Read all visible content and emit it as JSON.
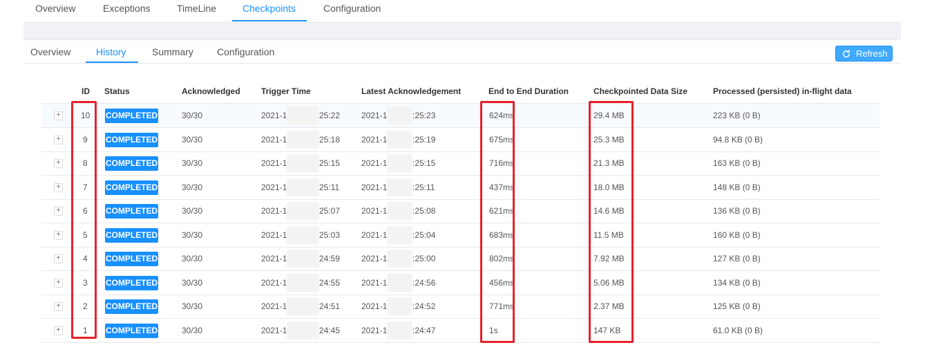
{
  "top_tabs": [
    "Overview",
    "Exceptions",
    "TimeLine",
    "Checkpoints",
    "Configuration"
  ],
  "top_active": "Checkpoints",
  "sub_tabs": [
    "Overview",
    "History",
    "Summary",
    "Configuration"
  ],
  "sub_active": "History",
  "refresh_label": "Refresh",
  "table": {
    "headers": [
      "ID",
      "Status",
      "Acknowledged",
      "Trigger Time",
      "Latest Acknowledgement",
      "End to End Duration",
      "Checkpointed Data Size",
      "Processed (persisted) in-flight data"
    ],
    "expand_symbol": "+",
    "rows": [
      {
        "id": "10",
        "status": "COMPLETED",
        "ack": "30/30",
        "trigger_prefix": "2021-1",
        "trigger_suffix": "25:22",
        "latest_prefix": "2021-1",
        "latest_suffix": ":25:23",
        "duration": "624ms",
        "size": "29.4 MB",
        "processed": "223 KB (0 B)"
      },
      {
        "id": "9",
        "status": "COMPLETED",
        "ack": "30/30",
        "trigger_prefix": "2021-1",
        "trigger_suffix": "25:18",
        "latest_prefix": "2021-1",
        "latest_suffix": ":25:19",
        "duration": "675ms",
        "size": "25.3 MB",
        "processed": "94.8 KB (0 B)"
      },
      {
        "id": "8",
        "status": "COMPLETED",
        "ack": "30/30",
        "trigger_prefix": "2021-1",
        "trigger_suffix": "25:15",
        "latest_prefix": "2021-1",
        "latest_suffix": ":25:15",
        "duration": "716ms",
        "size": "21.3 MB",
        "processed": "163 KB (0 B)"
      },
      {
        "id": "7",
        "status": "COMPLETED",
        "ack": "30/30",
        "trigger_prefix": "2021-1",
        "trigger_suffix": "25:11",
        "latest_prefix": "2021-1",
        "latest_suffix": ":25:11",
        "duration": "437ms",
        "size": "18.0 MB",
        "processed": "148 KB (0 B)"
      },
      {
        "id": "6",
        "status": "COMPLETED",
        "ack": "30/30",
        "trigger_prefix": "2021-1",
        "trigger_suffix": "25:07",
        "latest_prefix": "2021-1",
        "latest_suffix": ":25:08",
        "duration": "621ms",
        "size": "14.6 MB",
        "processed": "136 KB (0 B)"
      },
      {
        "id": "5",
        "status": "COMPLETED",
        "ack": "30/30",
        "trigger_prefix": "2021-1",
        "trigger_suffix": "25:03",
        "latest_prefix": "2021-1",
        "latest_suffix": ":25:04",
        "duration": "683ms",
        "size": "11.5 MB",
        "processed": "160 KB (0 B)"
      },
      {
        "id": "4",
        "status": "COMPLETED",
        "ack": "30/30",
        "trigger_prefix": "2021-1",
        "trigger_suffix": "24:59",
        "latest_prefix": "2021-1",
        "latest_suffix": ":25:00",
        "duration": "802ms",
        "size": "7.92 MB",
        "processed": "127 KB (0 B)"
      },
      {
        "id": "3",
        "status": "COMPLETED",
        "ack": "30/30",
        "trigger_prefix": "2021-1",
        "trigger_suffix": "24:55",
        "latest_prefix": "2021-1",
        "latest_suffix": ":24:56",
        "duration": "456ms",
        "size": "5.06 MB",
        "processed": "134 KB (0 B)"
      },
      {
        "id": "2",
        "status": "COMPLETED",
        "ack": "30/30",
        "trigger_prefix": "2021-1",
        "trigger_suffix": "24:51",
        "latest_prefix": "2021-1",
        "latest_suffix": ":24:52",
        "duration": "771ms",
        "size": "2.37 MB",
        "processed": "125 KB (0 B)"
      },
      {
        "id": "1",
        "status": "COMPLETED",
        "ack": "30/30",
        "trigger_prefix": "2021-1",
        "trigger_suffix": "24:45",
        "latest_prefix": "2021-1",
        "latest_suffix": ":24:47",
        "duration": "1s",
        "size": "147 KB",
        "processed": "61.0 KB (0 B)"
      }
    ]
  },
  "colors": {
    "accent": "#1890ff",
    "highlight_box": "#e8202a"
  },
  "icons": {
    "refresh": "refresh-icon"
  }
}
